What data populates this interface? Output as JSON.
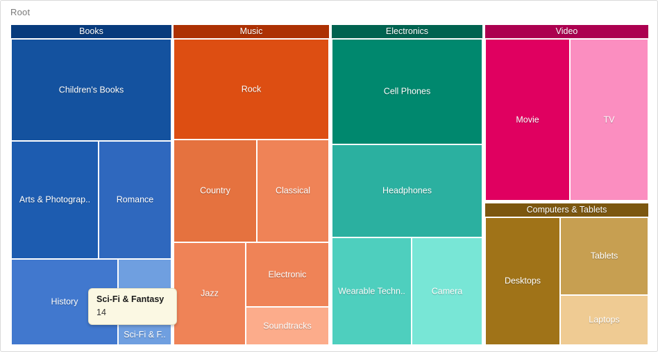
{
  "breadcrumb": {
    "label": "Root"
  },
  "colors": {
    "books_header": "#083b7d",
    "music_header": "#ad3103",
    "electronics_header": "#006350",
    "video_header": "#ac0050",
    "computers_header": "#7c5710",
    "tooltip_bg": "#fbf8e3",
    "frame_border": "#d9d9d9",
    "breadcrumb_text": "#7a7a7a"
  },
  "tooltip": {
    "title": "Sci-Fi & Fantasy",
    "value": "14"
  },
  "chart_data": {
    "type": "treemap",
    "title": "Root",
    "root": "Root",
    "groups": [
      {
        "name": "Books",
        "header_color": "#083b7d",
        "children": [
          {
            "name": "Children's Books",
            "label": "Children's Books",
            "color": "#14529f",
            "value": 52
          },
          {
            "name": "Arts & Photography",
            "label": "Arts & Photograp..",
            "color": "#1d5cb0",
            "value": 34
          },
          {
            "name": "Romance",
            "label": "Romance",
            "color": "#2f68be",
            "value": 26
          },
          {
            "name": "History",
            "label": "History",
            "color": "#4178ce",
            "value": 20
          },
          {
            "name": "Sci-Fi & Fantasy",
            "label": "Sci-Fi & F..",
            "color": "#6f9fe0",
            "value": 14
          }
        ]
      },
      {
        "name": "Music",
        "header_color": "#ad3103",
        "children": [
          {
            "name": "Rock",
            "label": "Rock",
            "color": "#dd4e12",
            "value": 45
          },
          {
            "name": "Country",
            "label": "Country",
            "color": "#e5723f",
            "value": 25
          },
          {
            "name": "Classical",
            "label": "Classical",
            "color": "#ef8357",
            "value": 20
          },
          {
            "name": "Jazz",
            "label": "Jazz",
            "color": "#ef8357",
            "value": 18
          },
          {
            "name": "Electronic",
            "label": "Electronic",
            "color": "#ef8357",
            "value": 16
          },
          {
            "name": "Soundtracks",
            "label": "Soundtracks",
            "color": "#fcac8b",
            "value": 9
          }
        ]
      },
      {
        "name": "Electronics",
        "header_color": "#006350",
        "children": [
          {
            "name": "Cell Phones",
            "label": "Cell Phones",
            "color": "#00886e",
            "value": 40
          },
          {
            "name": "Headphones",
            "label": "Headphones",
            "color": "#2bb0a0",
            "value": 32
          },
          {
            "name": "Wearable Technology",
            "label": "Wearable Techn..",
            "color": "#4ecfbe",
            "value": 22
          },
          {
            "name": "Camera",
            "label": "Camera",
            "color": "#78e6d6",
            "value": 19
          }
        ]
      },
      {
        "name": "Video",
        "header_color": "#ac0050",
        "children": [
          {
            "name": "Movie",
            "label": "Movie",
            "color": "#e00060",
            "value": 30
          },
          {
            "name": "TV",
            "label": "TV",
            "color": "#fb8ec0",
            "value": 27
          }
        ]
      },
      {
        "name": "Computers & Tablets",
        "header_color": "#7c5710",
        "children": [
          {
            "name": "Desktops",
            "label": "Desktops",
            "color": "#a07318",
            "value": 22
          },
          {
            "name": "Tablets",
            "label": "Tablets",
            "color": "#c79f51",
            "value": 16
          },
          {
            "name": "Laptops",
            "label": "Laptops",
            "color": "#efcb93",
            "value": 10
          }
        ]
      }
    ]
  }
}
